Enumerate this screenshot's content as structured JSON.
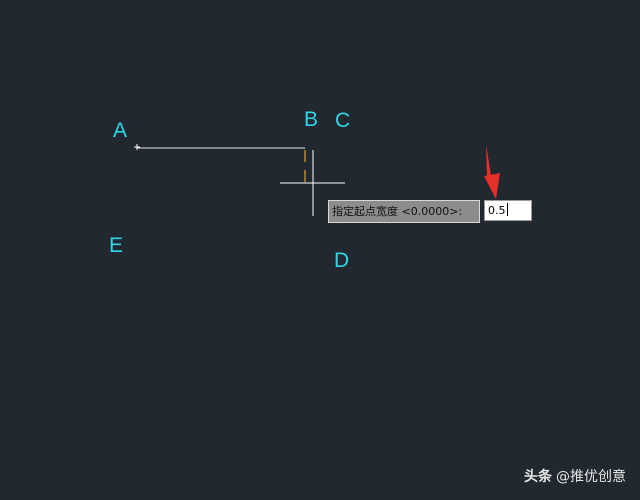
{
  "points": {
    "a": "A",
    "b": "B",
    "c": "C",
    "d": "D",
    "e": "E"
  },
  "command_prompt": {
    "text": "指定起点宽度 <0.0000>:",
    "input_value": "0.5"
  },
  "watermark": {
    "brand": "头条",
    "account": "@推优创意"
  },
  "colors": {
    "background": "#212830",
    "label": "#2fd6e8",
    "polyline": "#ffffff",
    "snap_marker": "#e8a020",
    "crosshair": "#ffffff",
    "arrow": "#e8302a",
    "prompt_background": "#8c8c8c",
    "input_background": "#ffffff"
  },
  "icons": {
    "cursor": "crosshair-cursor-icon",
    "pointer": "red-arrow-icon"
  }
}
